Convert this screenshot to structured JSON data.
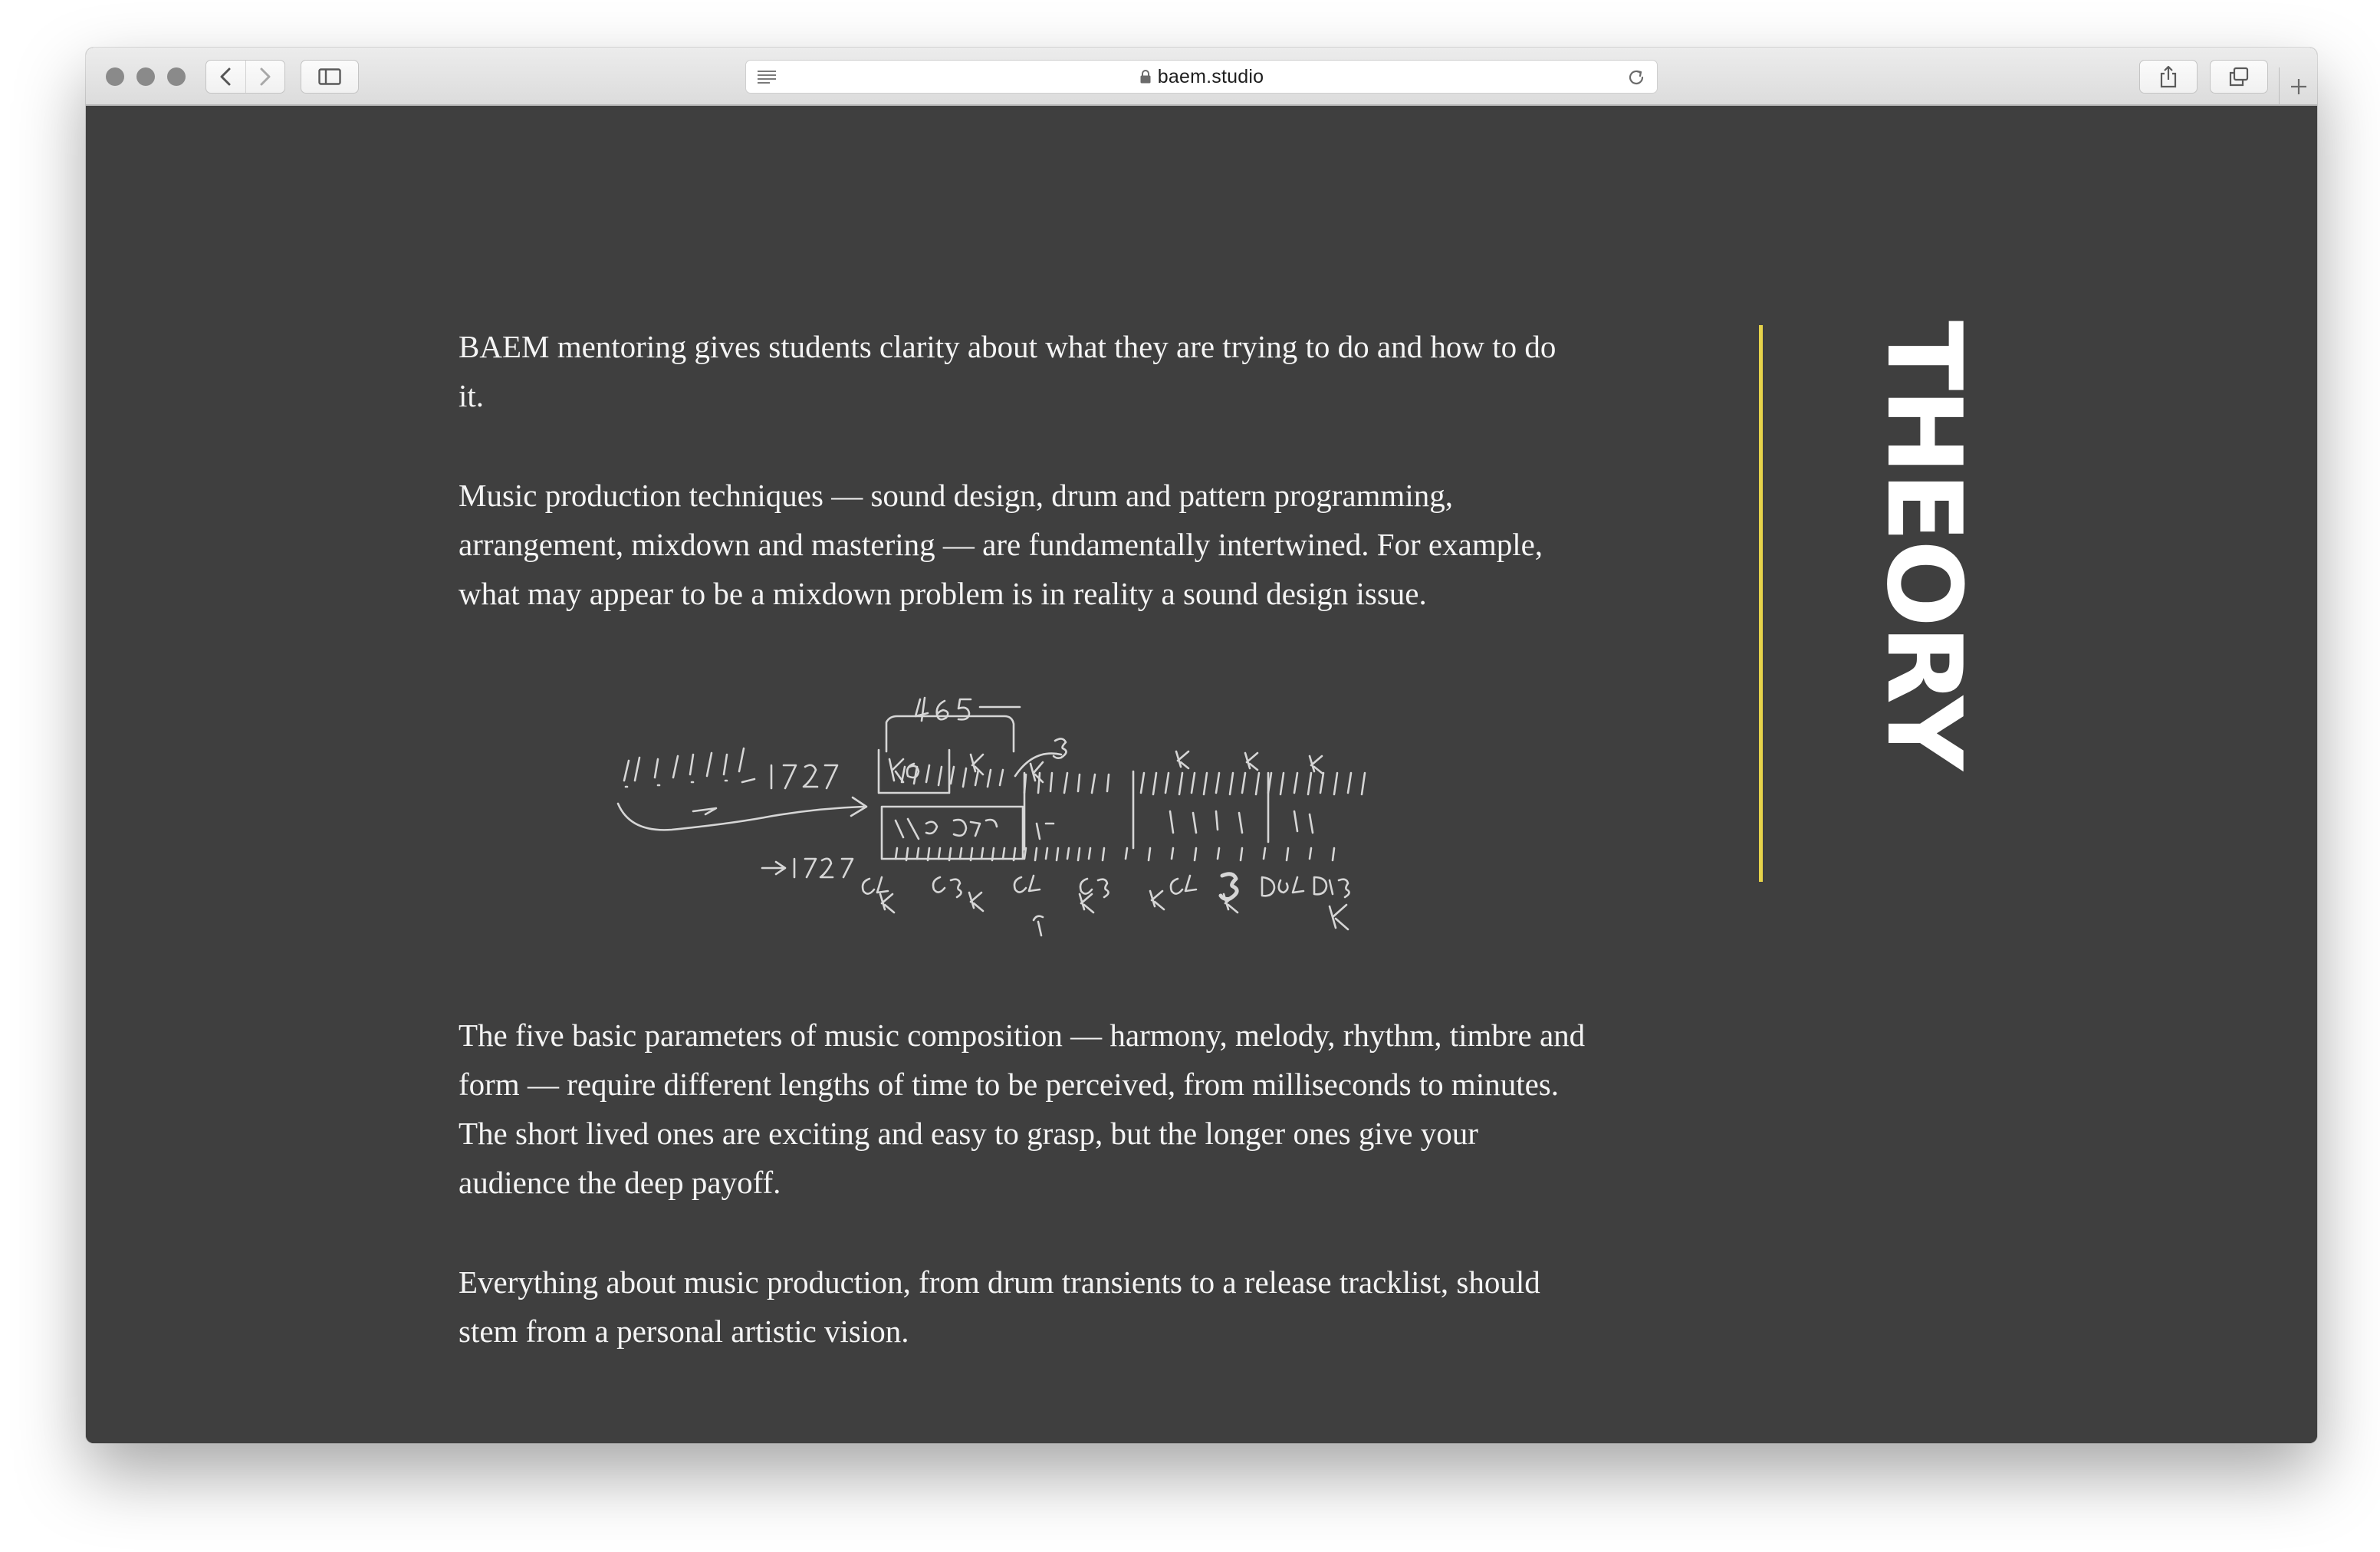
{
  "browser": {
    "url": "baem.studio"
  },
  "page": {
    "section_title": "THEORY",
    "paragraphs": [
      "BAEM mentoring gives students clarity about what they are trying to do and how to do it.",
      "Music production techniques — sound design, drum and pattern programming, arrangement, mixdown and mastering — are fundamentally intertwined. For example, what may appear to be a mixdown problem is in reality a sound design issue.",
      "The five basic parameters of music composition — harmony, melody, rhythm, timbre and form — require different lengths of time to be perceived, from milliseconds to minutes. The short lived ones are exciting and easy to grasp, but the longer ones give your audience the deep payoff.",
      "Everything about music production, from drum transients to a release tracklist, should stem from a personal artistic vision."
    ]
  },
  "colors": {
    "background": "#3f3f3f",
    "accent_line": "#e6d34a",
    "text": "#ffffff"
  },
  "icons": {
    "back": "chevron-left-icon",
    "forward": "chevron-right-icon",
    "sidebar": "sidebar-icon",
    "reader": "reader-icon",
    "lock": "lock-icon",
    "reload": "reload-icon",
    "share": "share-icon",
    "tabs": "tabs-icon",
    "new_tab": "plus-icon"
  }
}
